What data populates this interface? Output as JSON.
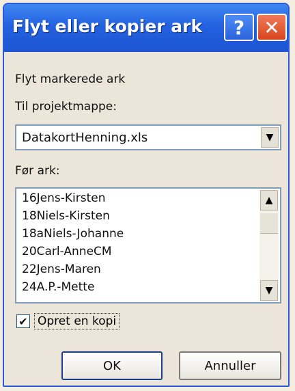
{
  "window": {
    "title": "Flyt eller kopier ark",
    "help_glyph": "?",
    "close_glyph": "✕"
  },
  "labels": {
    "move_selected": "Flyt markerede ark",
    "to_book": "Til projektmappe:",
    "before_sheet": "Før ark:"
  },
  "workbook_select": {
    "value": "DatakortHenning.xls"
  },
  "sheet_list": {
    "items": [
      "16Jens-Kirsten",
      "18Niels-Kirsten",
      "18aNiels-Johanne",
      "20Carl-AnneCM",
      "22Jens-Maren",
      "24A.P.-Mette"
    ]
  },
  "copy_option": {
    "label": "Opret en kopi",
    "checked": true
  },
  "buttons": {
    "ok": "OK",
    "cancel": "Annuller"
  },
  "glyphs": {
    "arrow_down": "▼",
    "arrow_up": "▲",
    "check": "✔"
  }
}
